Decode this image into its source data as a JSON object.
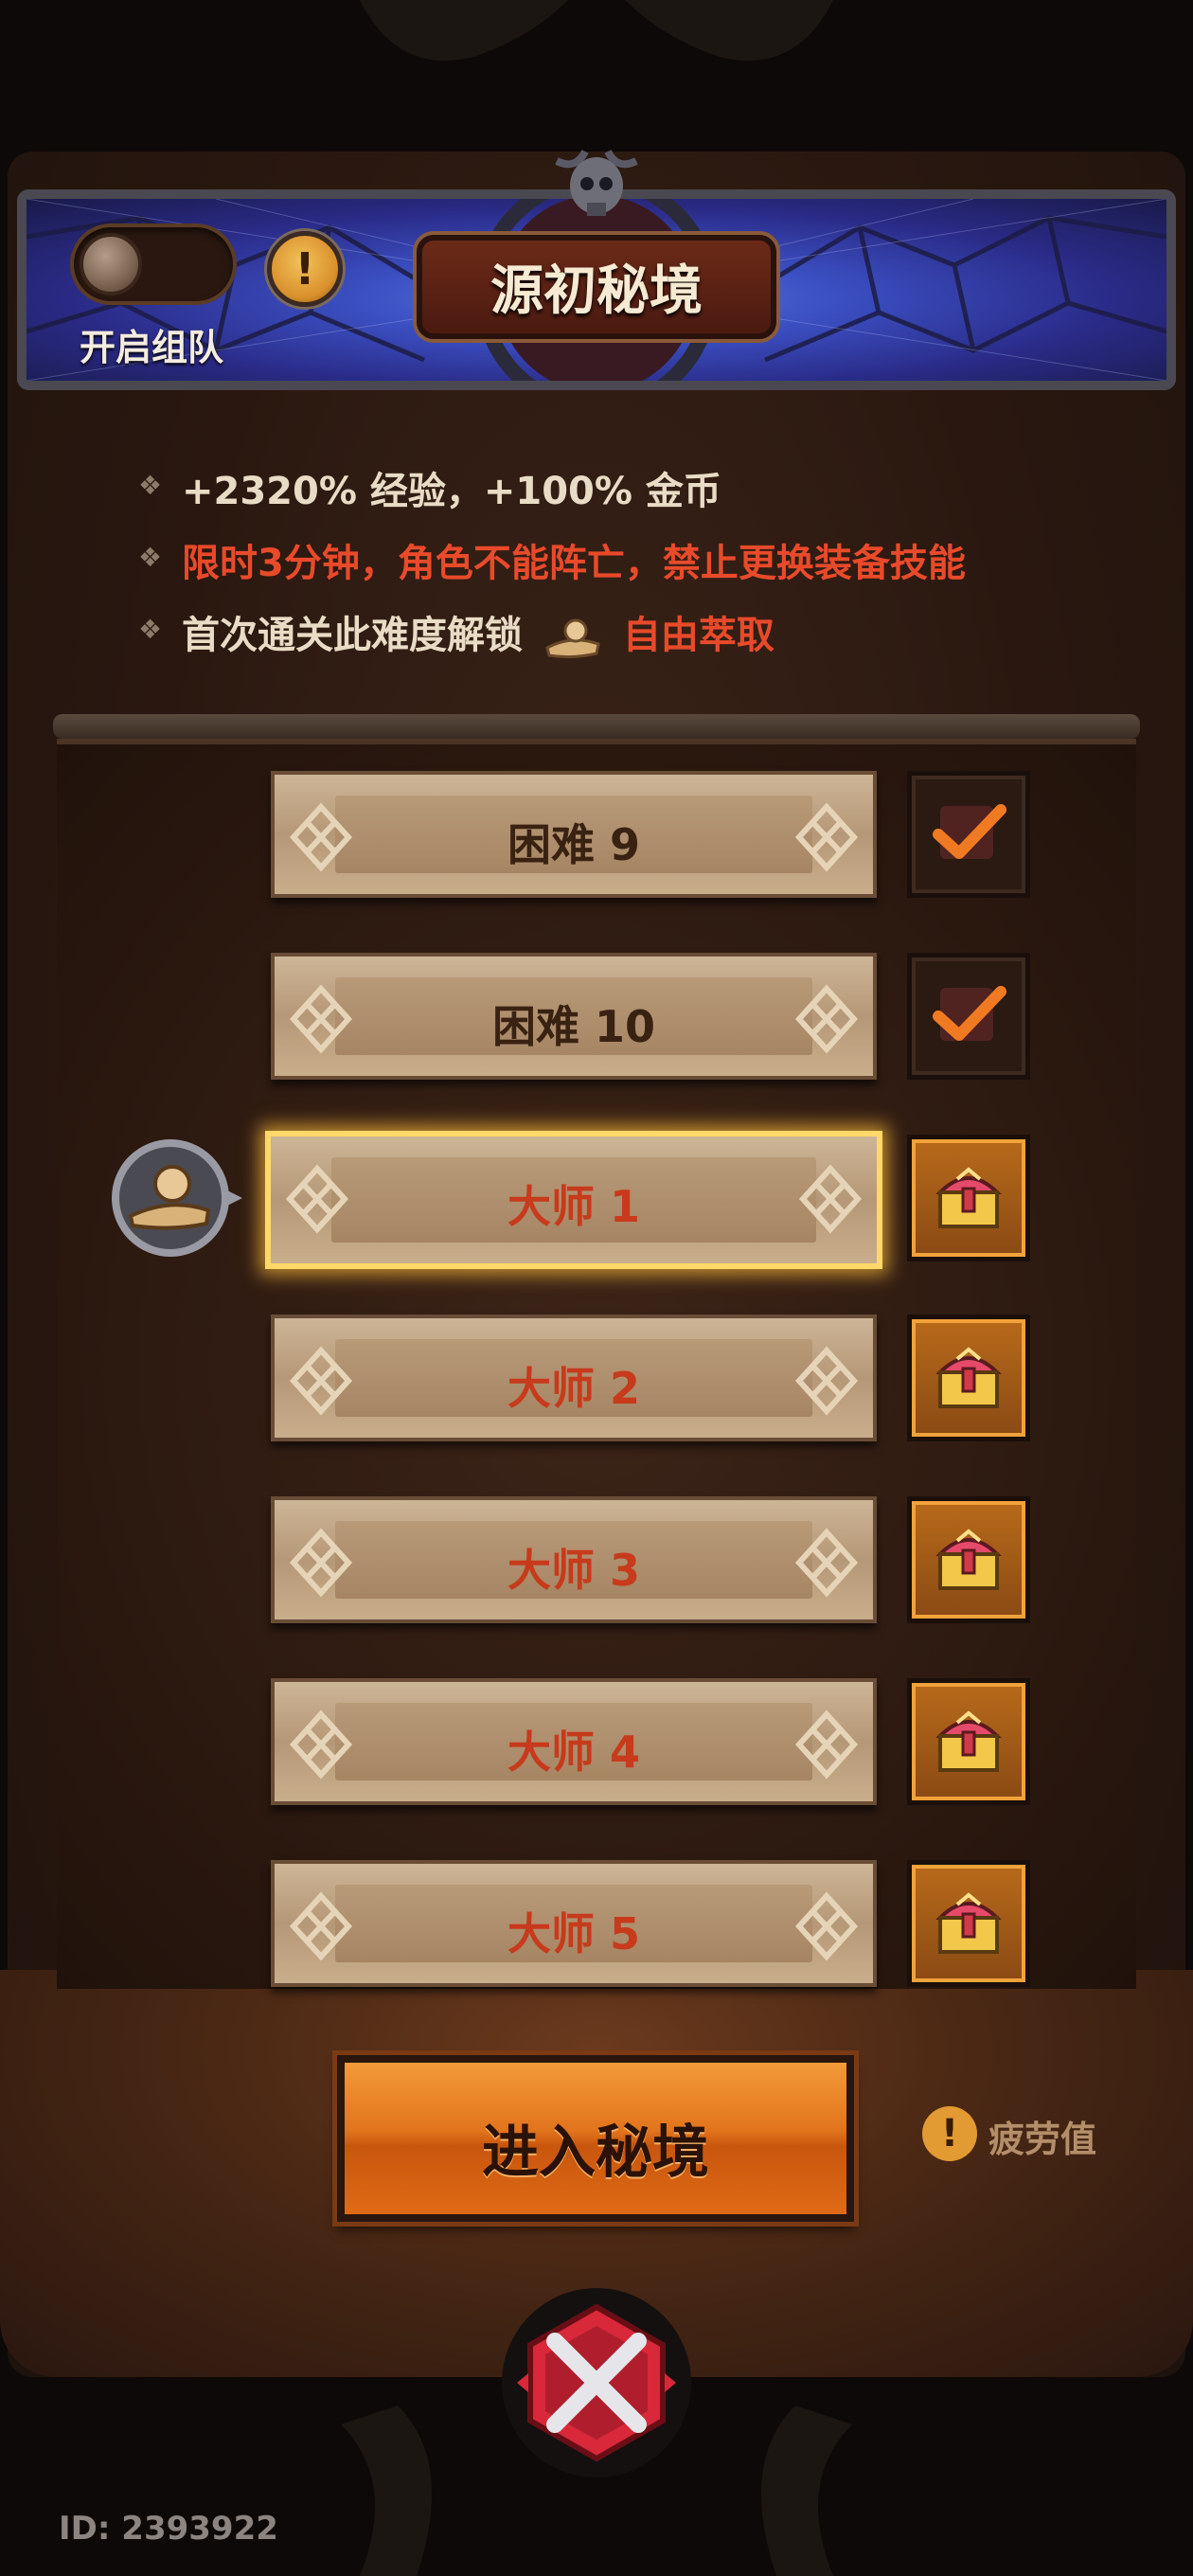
{
  "header": {
    "title": "源初秘境",
    "team_toggle_label": "开启组队",
    "info_symbol": "!"
  },
  "info": {
    "line1": "+2320% 经验，+100% 金币",
    "line2": "限时3分钟，角色不能阵亡，禁止更换装备技能",
    "line3_prefix": "首次通关此难度解锁",
    "line3_reward": "自由萃取"
  },
  "levels": [
    {
      "label": "困难 9",
      "status": "cleared"
    },
    {
      "label": "困难 10",
      "status": "cleared"
    },
    {
      "label": "大师 1",
      "status": "chest",
      "selected": true
    },
    {
      "label": "大师 2",
      "status": "chest"
    },
    {
      "label": "大师 3",
      "status": "chest"
    },
    {
      "label": "大师 4",
      "status": "chest"
    },
    {
      "label": "大师 5",
      "status": "chest"
    }
  ],
  "enter_button": "进入秘境",
  "fatigue": {
    "icon": "!",
    "label": "疲劳值"
  },
  "player_id": "ID: 2393922",
  "colors": {
    "accent_orange": "#e2741c",
    "warning_red": "#e84a2a",
    "selected_glow": "#ffd86a",
    "header_blue": "#3b4fc2"
  },
  "icons": [
    "info-icon",
    "check-icon",
    "chest-icon",
    "extract-icon",
    "close-icon",
    "skull-icon"
  ]
}
